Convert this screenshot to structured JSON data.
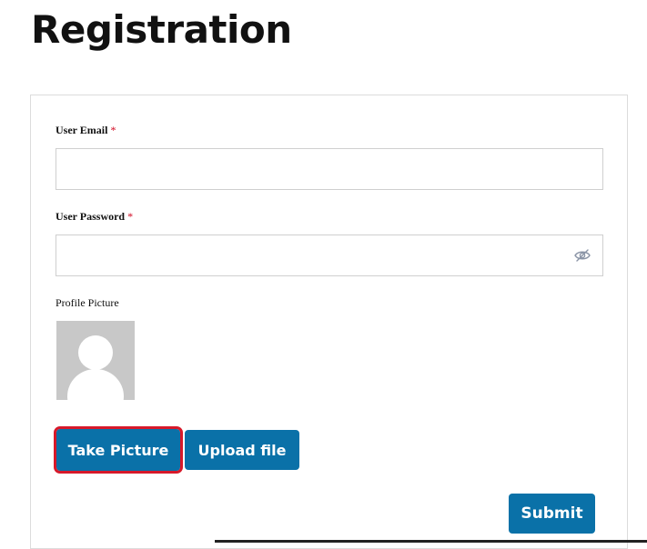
{
  "page": {
    "title": "Registration"
  },
  "form": {
    "email": {
      "label": "User Email",
      "required_mark": "*",
      "value": "",
      "placeholder": ""
    },
    "password": {
      "label": "User Password",
      "required_mark": "*",
      "value": "",
      "placeholder": "",
      "toggle_icon": "eye-slash-icon"
    },
    "profile_picture": {
      "label": "Profile Picture",
      "avatar_icon": "default-avatar-icon"
    },
    "buttons": {
      "take_picture": "Take Picture",
      "upload_file": "Upload file",
      "submit": "Submit"
    }
  },
  "colors": {
    "button_bg": "#0a71a8",
    "highlight_border": "#d7192a",
    "required_asterisk": "#d0021b",
    "avatar_bg": "#c8c8c8"
  }
}
